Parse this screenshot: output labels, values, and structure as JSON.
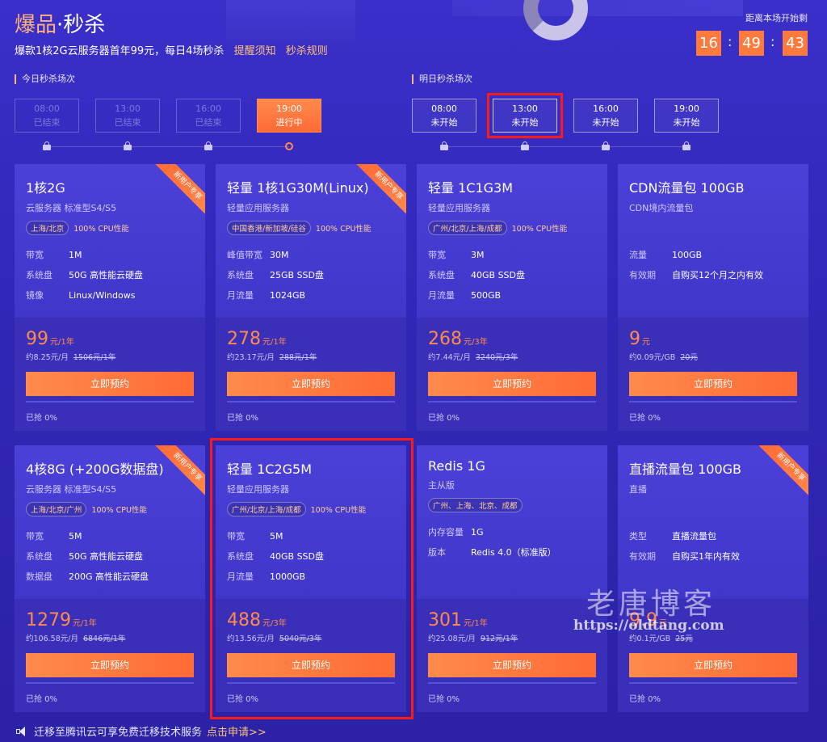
{
  "header": {
    "title_main": "爆品",
    "title_dot": "·",
    "title_kill": "秒杀",
    "subtitle": "爆款1核2G云服务器首年99元，每日4场秒杀",
    "link_reminder": "提醒须知",
    "link_rules": "秒杀规则",
    "countdown_label": "距离本场开始剩",
    "countdown": {
      "h": "16",
      "m": "49",
      "s": "43"
    },
    "sep": ":"
  },
  "today": {
    "label": "今日秒杀场次",
    "slots": [
      {
        "time": "08:00",
        "status": "已结束"
      },
      {
        "time": "13:00",
        "status": "已结束"
      },
      {
        "time": "16:00",
        "status": "已结束"
      },
      {
        "time": "19:00",
        "status": "进行中"
      }
    ]
  },
  "tomorrow": {
    "label": "明日秒杀场次",
    "slots": [
      {
        "time": "08:00",
        "status": "未开始"
      },
      {
        "time": "13:00",
        "status": "未开始"
      },
      {
        "time": "16:00",
        "status": "未开始"
      },
      {
        "time": "19:00",
        "status": "未开始"
      }
    ]
  },
  "ribbon_text": "新用户专享",
  "buy_label": "立即预约",
  "cards": [
    {
      "name": "1核2G",
      "type": "云服务器 标准型S4/S5",
      "region": "上海/北京",
      "cpu": "100% CPU性能",
      "specs": [
        {
          "k": "带宽",
          "v": "1M"
        },
        {
          "k": "系统盘",
          "v": "50G 高性能云硬盘"
        },
        {
          "k": "镜像",
          "v": "Linux/Windows"
        }
      ],
      "price": "99",
      "unit": "元/1年",
      "per": "约8.25元/月",
      "orig": "1506元/1年",
      "sold": "已抢 0%"
    },
    {
      "name": "轻量 1核1G30M(Linux)",
      "type": "轻量应用服务器",
      "region": "中国香港/新加坡/硅谷",
      "cpu": "100% CPU性能",
      "specs": [
        {
          "k": "峰值带宽",
          "v": "30M"
        },
        {
          "k": "系统盘",
          "v": "25GB SSD盘"
        },
        {
          "k": "月流量",
          "v": "1024GB"
        }
      ],
      "price": "278",
      "unit": "元/1年",
      "per": "约23.17元/月",
      "orig": "288元/1年",
      "sold": "已抢 0%"
    },
    {
      "name": "轻量 1C1G3M",
      "type": "轻量应用服务器",
      "region": "广州/北京/上海/成都",
      "cpu": "100% CPU性能",
      "specs": [
        {
          "k": "带宽",
          "v": "3M"
        },
        {
          "k": "系统盘",
          "v": "40GB SSD盘"
        },
        {
          "k": "月流量",
          "v": "500GB"
        }
      ],
      "price": "268",
      "unit": "元/3年",
      "per": "约7.44元/月",
      "orig": "3240元/3年",
      "sold": "已抢 0%"
    },
    {
      "name": "CDN流量包 100GB",
      "type": "CDN境内流量包",
      "region": "",
      "cpu": "",
      "specs": [
        {
          "k": "流量",
          "v": "100GB"
        },
        {
          "k": "有效期",
          "v": "自购买12个月之内有效"
        }
      ],
      "price": "9",
      "unit": "元",
      "per": "约0.09元/GB",
      "orig": "20元",
      "sold": "已抢 0%"
    },
    {
      "name": "4核8G (+200G数据盘)",
      "type": "云服务器 标准型S4/S5",
      "region": "上海/北京/广州",
      "cpu": "100% CPU性能",
      "specs": [
        {
          "k": "带宽",
          "v": "5M"
        },
        {
          "k": "系统盘",
          "v": "50G 高性能云硬盘"
        },
        {
          "k": "数据盘",
          "v": "200G 高性能云硬盘"
        }
      ],
      "price": "1279",
      "unit": "元/1年",
      "per": "约106.58元/月",
      "orig": "6846元/1年",
      "sold": "已抢 0%"
    },
    {
      "name": "轻量 1C2G5M",
      "type": "轻量应用服务器",
      "region": "广州/北京/上海/成都",
      "cpu": "100% CPU性能",
      "specs": [
        {
          "k": "带宽",
          "v": "5M"
        },
        {
          "k": "系统盘",
          "v": "40GB SSD盘"
        },
        {
          "k": "月流量",
          "v": "1000GB"
        }
      ],
      "price": "488",
      "unit": "元/3年",
      "per": "约13.56元/月",
      "orig": "5040元/3年",
      "sold": "已抢 0%"
    },
    {
      "name": "Redis 1G",
      "type": "主从版",
      "region": "广州、上海、北京、成都",
      "cpu": "",
      "specs": [
        {
          "k": "内存容量",
          "v": "1G"
        },
        {
          "k": "版本",
          "v": "Redis 4.0（标准版）"
        }
      ],
      "price": "301",
      "unit": "元/1年",
      "per": "约25.08元/月",
      "orig": "912元/1年",
      "sold": "已抢 0%"
    },
    {
      "name": "直播流量包 100GB",
      "type": "直播",
      "region": "",
      "cpu": "",
      "specs": [
        {
          "k": "类型",
          "v": "直播流量包"
        },
        {
          "k": "有效期",
          "v": "自购买1年内有效"
        }
      ],
      "price": "9.9",
      "unit": "元",
      "per": "约0.1元/GB",
      "orig": "25元",
      "sold": "已抢 0%"
    }
  ],
  "watermark": {
    "cn": "老唐博客",
    "url": "https://oldtang.com"
  },
  "footer": {
    "text": "迁移至腾讯云可享免费迁移技术服务",
    "link": "点击申请>>"
  }
}
